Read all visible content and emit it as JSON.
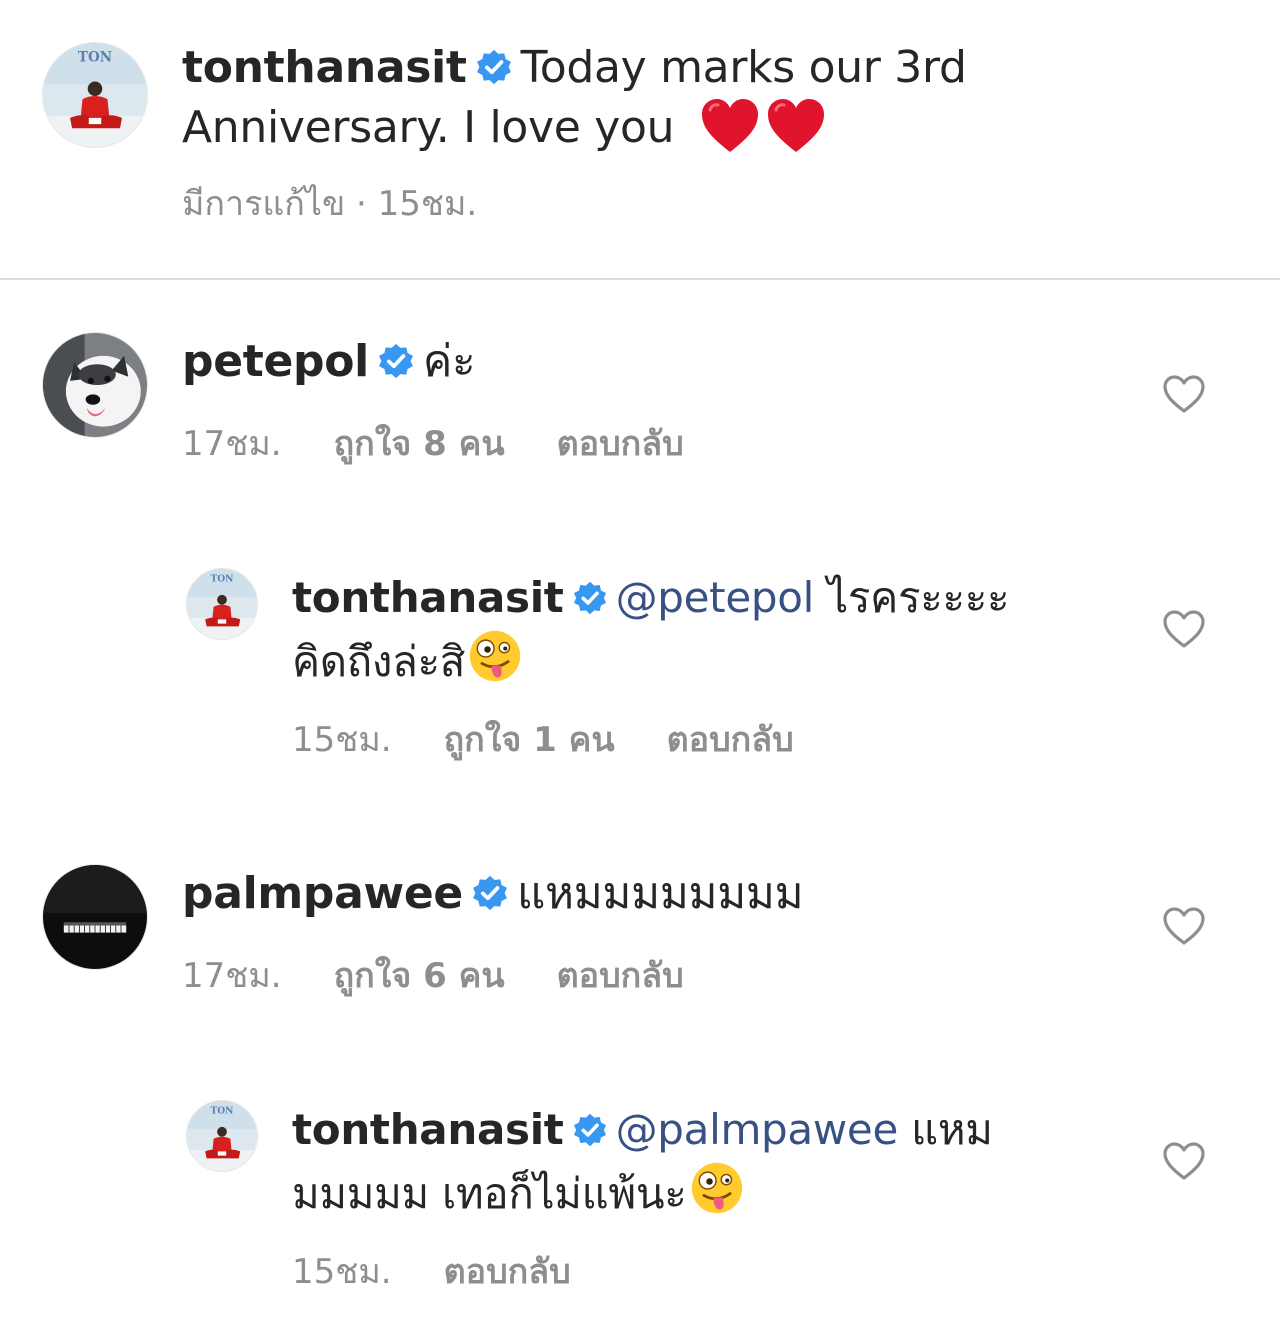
{
  "caption": {
    "username": "tonthanasit",
    "text": "Today marks our 3rd Anniversary. I love you",
    "hearts": [
      "❤️",
      "❤️"
    ],
    "edited_label": "มีการแก้ไข",
    "separator": "·",
    "time": "15ชม."
  },
  "comments": [
    {
      "username": "petepol",
      "text": "ค่ะ",
      "time": "17ชม.",
      "likes_label": "ถูกใจ 8 คน",
      "reply_label": "ตอบกลับ",
      "avatar_icon": "husky-dog-avatar"
    },
    {
      "username": "tonthanasit",
      "mention": "@petepol",
      "text_line1": "ไรคระะะะ",
      "text_line2": "คิดถึงล่ะสิ",
      "emoji": "zany-face",
      "time": "15ชม.",
      "likes_label": "ถูกใจ 1 คน",
      "reply_label": "ตอบกลับ"
    },
    {
      "username": "palmpawee",
      "text": "แหมมมมมมมม",
      "time": "17ชม.",
      "likes_label": "ถูกใจ 6 คน",
      "reply_label": "ตอบกลับ",
      "avatar_icon": "piano-avatar"
    },
    {
      "username": "tonthanasit",
      "mention": "@palmpawee",
      "text_line1": "แหม",
      "text_line2": "มมมมม เทอก็ไม่แพ้นะ",
      "emoji": "zany-face",
      "time": "15ชม.",
      "reply_label": "ตอบกลับ"
    }
  ],
  "colors": {
    "verified": "#3897f0",
    "mention": "#385185",
    "meta": "#8e8e8e",
    "heart_outline": "#8e8e8e"
  },
  "avatar_text": "TON"
}
